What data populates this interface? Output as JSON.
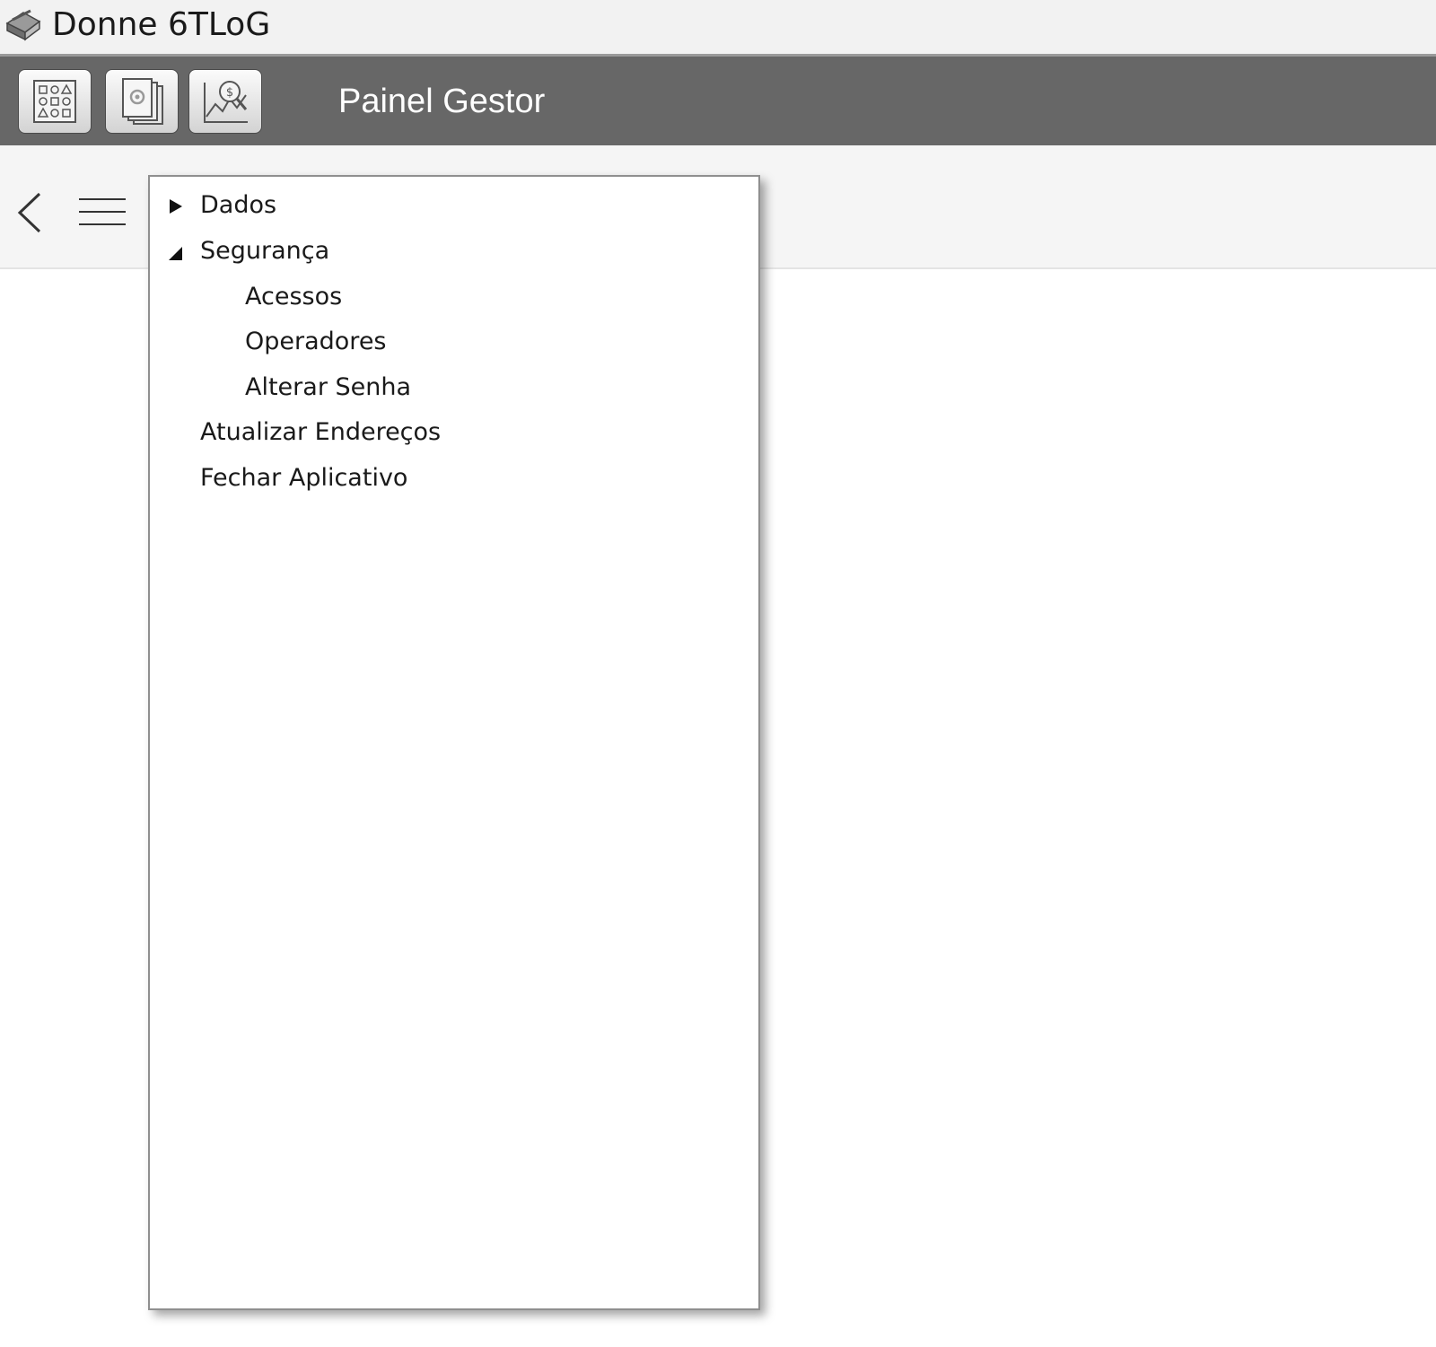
{
  "window": {
    "title": "Donne 6TLoG",
    "app_icon": "app-logo-icon"
  },
  "toolbar": {
    "panel_title": "Painel Gestor",
    "buttons": [
      {
        "name": "dashboard",
        "icon": "dashboard-grid-icon"
      },
      {
        "name": "documents",
        "icon": "documents-settings-icon"
      },
      {
        "name": "reports",
        "icon": "financial-chart-icon"
      }
    ]
  },
  "navbar": {
    "back_icon": "chevron-left-icon",
    "menu_icon": "hamburger-menu-icon"
  },
  "menu": {
    "items": [
      {
        "label": "Dados",
        "expander": "collapsed",
        "level": 0
      },
      {
        "label": "Segurança",
        "expander": "expanded",
        "level": 0
      },
      {
        "label": "Acessos",
        "expander": "none",
        "level": 1
      },
      {
        "label": "Operadores",
        "expander": "none",
        "level": 1
      },
      {
        "label": "Alterar Senha",
        "expander": "none",
        "level": 1
      },
      {
        "label": "Atualizar Endereços",
        "expander": "none",
        "level": 0
      },
      {
        "label": "Fechar Aplicativo",
        "expander": "none",
        "level": 0
      }
    ]
  }
}
